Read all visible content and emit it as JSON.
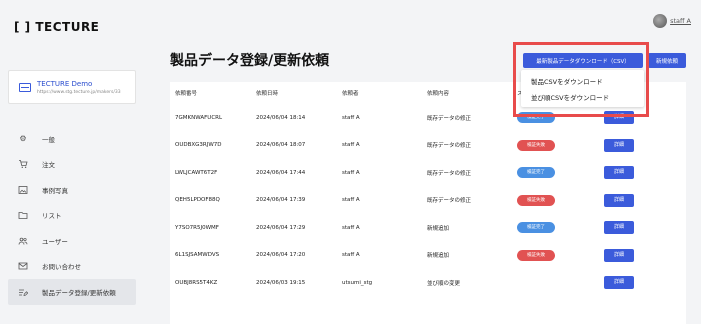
{
  "app": {
    "logo": "[ ] TECTURE"
  },
  "user": {
    "name": "staff A"
  },
  "project": {
    "name": "TECTURE Demo",
    "url": "https://www.stg.tecture.jp/makers/33"
  },
  "sidebar": {
    "items": [
      {
        "label": "一般",
        "icon": "gear-icon"
      },
      {
        "label": "注文",
        "icon": "cart-icon"
      },
      {
        "label": "事例写真",
        "icon": "photo-icon"
      },
      {
        "label": "リスト",
        "icon": "folder-icon"
      },
      {
        "label": "ユーザー",
        "icon": "users-icon"
      },
      {
        "label": "お問い合わせ",
        "icon": "mail-icon"
      },
      {
        "label": "製品データ登録/更新依頼",
        "icon": "edit-list-icon",
        "active": true
      }
    ]
  },
  "page": {
    "title": "製品データ登録/更新依頼"
  },
  "actions": {
    "download_label": "最新製品データダウンロード（CSV）",
    "new_request_label": "新規依頼"
  },
  "download_menu": {
    "items": [
      "製品CSVをダウンロード",
      "並び順CSVをダウンロード"
    ]
  },
  "table": {
    "headers": [
      "依頼番号",
      "依頼日時",
      "依頼者",
      "依頼内容",
      "ス",
      ""
    ],
    "rows": [
      {
        "id": "7GMKNWAFUCRL",
        "date": "2024/06/04 18:14",
        "requester": "staff A",
        "content": "既存データの修正",
        "status": "検証完了",
        "status_type": "ok",
        "action": "詳細"
      },
      {
        "id": "OUDBXG3RJW7D",
        "date": "2024/06/04 18:07",
        "requester": "staff A",
        "content": "既存データの修正",
        "status": "検証失敗",
        "status_type": "ng",
        "action": "詳細"
      },
      {
        "id": "LWLJCAWT6T2F",
        "date": "2024/06/04 17:44",
        "requester": "staff A",
        "content": "既存データの修正",
        "status": "検証完了",
        "status_type": "ok",
        "action": "詳細"
      },
      {
        "id": "QEH5LPDOF88Q",
        "date": "2024/06/04 17:39",
        "requester": "staff A",
        "content": "既存データの修正",
        "status": "検証失敗",
        "status_type": "ng",
        "action": "詳細"
      },
      {
        "id": "Y7SO7R5J0WMF",
        "date": "2024/06/04 17:29",
        "requester": "staff A",
        "content": "新規追加",
        "status": "検証完了",
        "status_type": "ok",
        "action": "詳細"
      },
      {
        "id": "6L1SJSAMWDVS",
        "date": "2024/06/04 17:20",
        "requester": "staff A",
        "content": "新規追加",
        "status": "検証失敗",
        "status_type": "ng",
        "action": "詳細"
      },
      {
        "id": "OUBJ8RS5T4KZ",
        "date": "2024/06/03 19:15",
        "requester": "utsumi_stg",
        "content": "並び順の変更",
        "status": "",
        "status_type": "",
        "action": "詳細"
      }
    ]
  },
  "colors": {
    "primary": "#3b5bdb",
    "ok": "#4a90e2",
    "ng": "#e15252",
    "highlight": "#e84b4b"
  }
}
